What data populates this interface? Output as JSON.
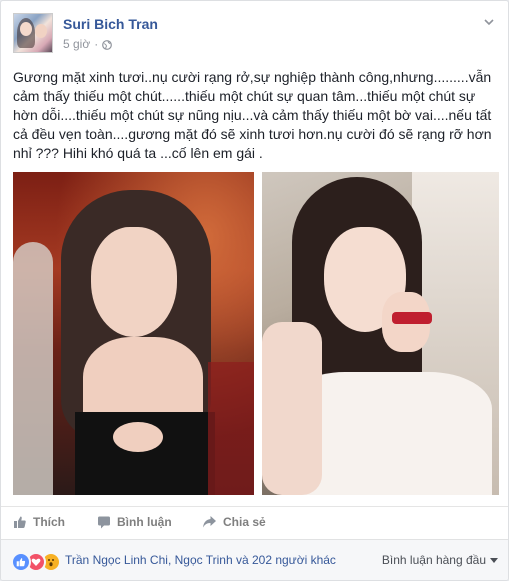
{
  "post": {
    "author": "Suri Bich Tran",
    "time": "5 giờ",
    "separator": "·",
    "text": "Gương mặt xinh tươi..nụ cười rạng rở,sự nghiệp thành công,nhưng.........vẫn cảm thấy thiếu một chút......thiếu một chút sự quan tâm...thiếu một chút sự hờn dỗi....thiếu một chút sự nũng nịu...và cảm thấy thiếu một bờ vai....nếu tất cả đều vẹn toàn....gương mặt đó sẽ xinh tươi hơn.nụ cười đó sẽ rạng rỡ hơn nhỉ ??? Hihi khó quá ta ...cố lên em gái ."
  },
  "actions": {
    "like": "Thích",
    "comment": "Bình luận",
    "share": "Chia sẻ"
  },
  "footer": {
    "likers": "Trần Ngọc Linh Chi, Ngọc Trinh và 202 người khác",
    "sort": "Bình luận hàng đầu"
  },
  "icons": {
    "privacy": "globe-icon",
    "menu": "chevron-down-icon",
    "like": "thumbs-up-icon",
    "comment": "comment-icon",
    "share": "share-icon",
    "reactions": [
      "like-reaction-icon",
      "love-reaction-icon",
      "wow-reaction-icon"
    ]
  },
  "colors": {
    "link": "#365899",
    "muted": "#90949c",
    "like": "#5890ff",
    "love": "#f25268",
    "wow": "#f7b125"
  }
}
